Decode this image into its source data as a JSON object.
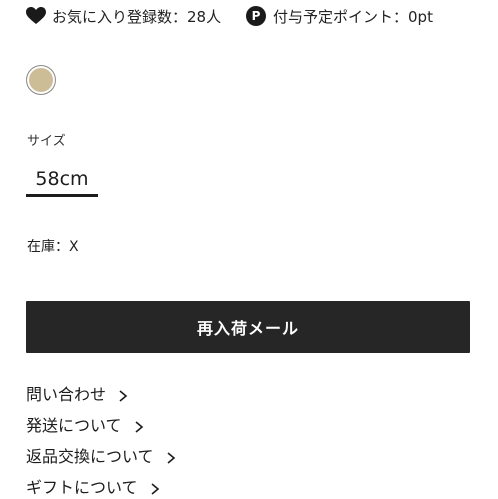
{
  "info_bar": {
    "favorites_text": "お気に入り登録数：28人",
    "point_badge": "P",
    "points_text": "付与予定ポイント：0pt"
  },
  "color_swatch": {
    "color": "#ccbd97"
  },
  "size": {
    "label": "サイズ",
    "selected_option": "58cm"
  },
  "stock": {
    "text": "在庫：X"
  },
  "restock_button": {
    "label": "再入荷メール",
    "background": "#262626"
  },
  "links": [
    {
      "label": "問い合わせ"
    },
    {
      "label": "発送について"
    },
    {
      "label": "返品交換について"
    },
    {
      "label": "ギフトについて"
    }
  ]
}
